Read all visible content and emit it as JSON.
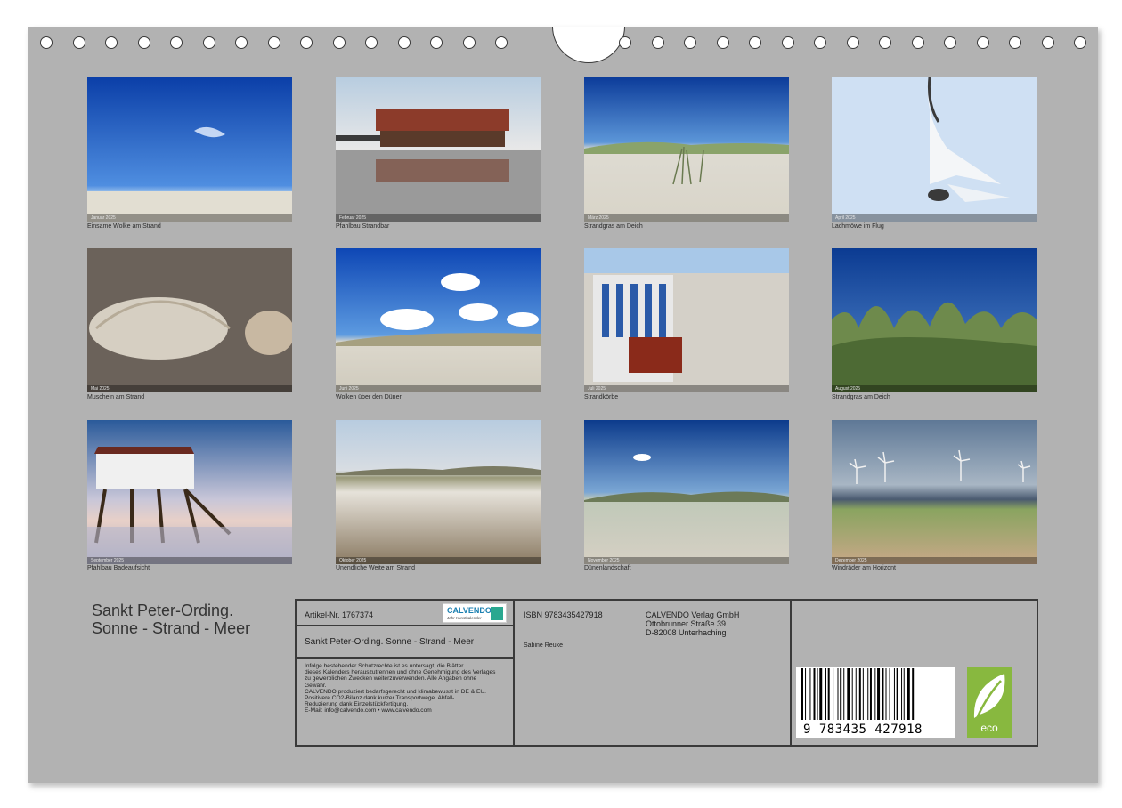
{
  "photos": [
    {
      "caption": "Einsame Wolke am Strand",
      "month": "Januar 2025"
    },
    {
      "caption": "Pfahlbau Strandbar",
      "month": "Februar 2025"
    },
    {
      "caption": "Strandgras am Deich",
      "month": "März 2025"
    },
    {
      "caption": "Lachmöwe im Flug",
      "month": "April 2025"
    },
    {
      "caption": "Muscheln am Strand",
      "month": "Mai 2025"
    },
    {
      "caption": "Wolken über den Dünen",
      "month": "Juni 2025"
    },
    {
      "caption": "Strandkörbe",
      "month": "Juli 2025"
    },
    {
      "caption": "Strandgras am Deich",
      "month": "August 2025"
    },
    {
      "caption": "Pfahlbau Badeaufsicht",
      "month": "September 2025"
    },
    {
      "caption": "Unendliche Weite am Strand",
      "month": "Oktober 2025"
    },
    {
      "caption": "Dünenlandschaft",
      "month": "November 2025"
    },
    {
      "caption": "Windräder am Horizont",
      "month": "Dezember 2025"
    }
  ],
  "title": {
    "line1": "Sankt Peter-Ording.",
    "line2": "Sonne - Strand - Meer"
  },
  "info": {
    "artikel": "Artikel-Nr. 1767374",
    "logo_text": "CALVENDO",
    "logo_sub": "Jahr Kunstkalender",
    "subtitle": "Sankt Peter-Ording. Sonne - Strand - Meer",
    "legal": [
      "Infolge bestehender Schutzrechte ist es untersagt, die Blätter",
      "dieses Kalenders herauszutrennen und ohne Genehmigung des Verlages",
      "zu gewerblichen Zwecken weiterzuverwenden. Alle Angaben ohne",
      "Gewähr.",
      "CALVENDO produziert bedarfsgerecht und klimabewusst in DE & EU.",
      "Positivere CO2-Bilanz dank kurzer Transportwege. Abfall-",
      "Reduzierung dank Einzelstückfertigung.",
      "E-Mail: info@calvendo.com • www.calvendo.com"
    ],
    "isbn": "ISBN 9783435427918",
    "author": "Sabine Reuke",
    "publisher": [
      "CALVENDO Verlag GmbH",
      "Ottobrunner Straße 39",
      "D-82008 Unterhaching"
    ],
    "barcode_digits": "9 783435 427918",
    "eco_label": "eco"
  },
  "colors": {
    "sheet": "#b2b2b2",
    "frame": "#3a3a3a",
    "eco_green": "#88b83f"
  }
}
